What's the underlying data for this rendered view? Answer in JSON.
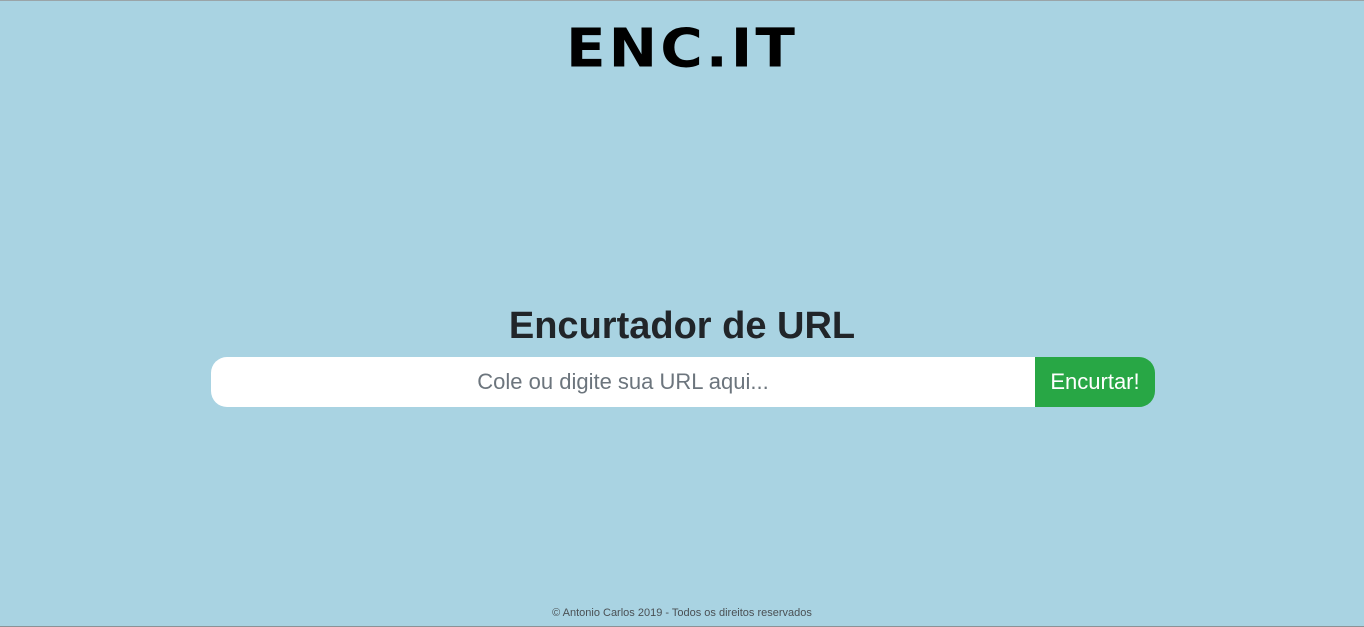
{
  "header": {
    "logo_text": "ENC.IT"
  },
  "main": {
    "title": "Encurtador de URL",
    "url_input": {
      "value": "",
      "placeholder": "Cole ou digite sua URL aqui..."
    },
    "submit_label": "Encurtar!"
  },
  "footer": {
    "text": "© Antonio Carlos 2019 - Todos os direitos reservados"
  },
  "colors": {
    "background": "#a9d3e2",
    "button": "#28a745",
    "title": "#212529"
  }
}
